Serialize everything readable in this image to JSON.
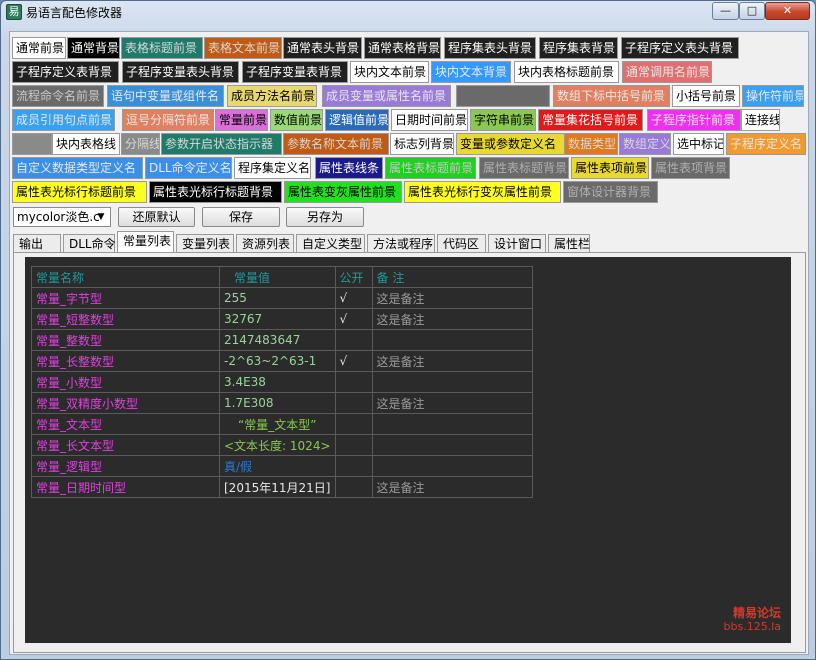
{
  "window": {
    "title": "易语言配色修改器",
    "minimize_glyph": "—",
    "maximize_glyph": "□",
    "close_glyph": "✕"
  },
  "color_buttons": [
    {
      "label": "通常前景",
      "bg": "#ffffff",
      "fg": "#000000"
    },
    {
      "label": "通常背景",
      "bg": "#000000",
      "fg": "#ffffff"
    },
    {
      "label": "表格标题前景",
      "bg": "#1f7a6a",
      "fg": "#d8d8d8"
    },
    {
      "label": "表格文本前景",
      "bg": "#c05a14",
      "fg": "#d8d8d8"
    },
    {
      "label": "通常表头背景",
      "bg": "#202020",
      "fg": "#ffffff"
    },
    {
      "label": "通常表格背景",
      "bg": "#202020",
      "fg": "#ffffff"
    },
    {
      "label": "程序集表头背景",
      "bg": "#202020",
      "fg": "#ffffff"
    },
    {
      "label": "程序集表背景",
      "bg": "#202020",
      "fg": "#ffffff"
    },
    {
      "label": "子程序定义表头背景",
      "bg": "#202020",
      "fg": "#ffffff"
    },
    {
      "label": "子程序定义表背景",
      "bg": "#202020",
      "fg": "#ffffff"
    },
    {
      "label": "子程序变量表头背景",
      "bg": "#202020",
      "fg": "#ffffff"
    },
    {
      "label": "子程序变量表背景",
      "bg": "#202020",
      "fg": "#ffffff"
    },
    {
      "label": "块内文本前景",
      "bg": "#ffffff",
      "fg": "#000000"
    },
    {
      "label": "块内文本背景",
      "bg": "#3399ff",
      "fg": "#e8e8e8"
    },
    {
      "label": "块内表格标题前景",
      "bg": "#ffffff",
      "fg": "#000000"
    },
    {
      "label": "通常调用名前景",
      "bg": "#e07070",
      "fg": "#e8e8e8"
    },
    {
      "label": "流程命令名前景",
      "bg": "#6a6a6a",
      "fg": "#c8c8c8"
    },
    {
      "label": "语句中变量或组件名",
      "bg": "#3a90d8",
      "fg": "#e8e8e8"
    },
    {
      "label": "成员方法名前景",
      "bg": "#e8d870",
      "fg": "#000000"
    },
    {
      "label": "成员变量或属性名前景",
      "bg": "#9a7ad8",
      "fg": "#e8e8e8"
    },
    {
      "label": "",
      "bg": "#6a6a6a",
      "fg": "#ffffff"
    },
    {
      "label": "数组下标中括号前景",
      "bg": "#e08060",
      "fg": "#e8e8e8"
    },
    {
      "label": "小括号前景",
      "bg": "#ffffff",
      "fg": "#000000"
    },
    {
      "label": "操作符前景",
      "bg": "#3aa0f0",
      "fg": "#e8e8e8"
    },
    {
      "label": "成员引用句点前景",
      "bg": "#3aa0f0",
      "fg": "#e8e8e8"
    },
    {
      "label": "逗号分隔符前景",
      "bg": "#e08060",
      "fg": "#e8e8e8"
    },
    {
      "label": "常量前景",
      "bg": "#d870d8",
      "fg": "#000000"
    },
    {
      "label": "数值前景",
      "bg": "#9ad878",
      "fg": "#000000"
    },
    {
      "label": "逻辑值前景",
      "bg": "#2a6ab8",
      "fg": "#ffffff"
    },
    {
      "label": "日期时间前景",
      "bg": "#ffffff",
      "fg": "#000000"
    },
    {
      "label": "字符串前景",
      "bg": "#8ac850",
      "fg": "#000000"
    },
    {
      "label": "常量集花括号前景",
      "bg": "#e01a1a",
      "fg": "#ffffff"
    },
    {
      "label": "子程序指针前景",
      "bg": "#f030f0",
      "fg": "#e8e8e8"
    },
    {
      "label": "连接线",
      "bg": "#ffffff",
      "fg": "#000000"
    },
    {
      "label": "",
      "bg": "#8a8a8a",
      "fg": "#ffffff"
    },
    {
      "label": "块内表格线",
      "bg": "#ffffff",
      "fg": "#000000"
    },
    {
      "label": "分隔线",
      "bg": "#8a8a8a",
      "fg": "#d8d8d8"
    },
    {
      "label": "参数开启状态指示器",
      "bg": "#1f7a6a",
      "fg": "#d8d8d8"
    },
    {
      "label": "参数名称文本前景",
      "bg": "#c05a14",
      "fg": "#d8d8d8"
    },
    {
      "label": "标志列背景",
      "bg": "#ffffff",
      "fg": "#000000"
    },
    {
      "label": "变量或参数定义名",
      "bg": "#e8d830",
      "fg": "#000000"
    },
    {
      "label": "数据类型",
      "bg": "#e07a1a",
      "fg": "#d8d8d8"
    },
    {
      "label": "数组定义",
      "bg": "#9a7ad8",
      "fg": "#d8d8d8"
    },
    {
      "label": "选中标记",
      "bg": "#ffffff",
      "fg": "#000000"
    },
    {
      "label": "子程序定义名",
      "bg": "#f09a30",
      "fg": "#e8e8e8"
    },
    {
      "label": "自定义数据类型定义名",
      "bg": "#3a90e8",
      "fg": "#e8e8e8"
    },
    {
      "label": "DLL命令定义名",
      "bg": "#3a90e8",
      "fg": "#e8e8e8"
    },
    {
      "label": "程序集定义名",
      "bg": "#ffffff",
      "fg": "#000000"
    },
    {
      "label": "属性表线条",
      "bg": "#1a1a8a",
      "fg": "#ffffff"
    },
    {
      "label": "属性表标题前景",
      "bg": "#20d020",
      "fg": "#c8c8c8"
    },
    {
      "label": "属性表标题背景",
      "bg": "#6a6a6a",
      "fg": "#b0b0b0"
    },
    {
      "label": "属性表项前景",
      "bg": "#e8d830",
      "fg": "#000000"
    },
    {
      "label": "属性表项背景",
      "bg": "#6a6a6a",
      "fg": "#b0b0b0"
    },
    {
      "label": "属性表光标行标题前景",
      "bg": "#ffff20",
      "fg": "#000000"
    },
    {
      "label": "属性表光标行标题背景",
      "bg": "#000000",
      "fg": "#ffffff"
    },
    {
      "label": "属性表变灰属性前景",
      "bg": "#20e020",
      "fg": "#000000"
    },
    {
      "label": "属性表光标行变灰属性前景",
      "bg": "#ffff20",
      "fg": "#000000"
    },
    {
      "label": "窗体设计器背景",
      "bg": "#6a6a6a",
      "fg": "#b0b0b0"
    }
  ],
  "toolbar": {
    "combo_value": "mycolor淡色.c",
    "restore_label": "还原默认",
    "save_label": "保存",
    "save_as_label": "另存为"
  },
  "tabs": [
    "输出",
    "DLL命令",
    "常量列表",
    "变量列表",
    "资源列表",
    "自定义类型",
    "方法或程序",
    "代码区",
    "设计窗口",
    "属性栏"
  ],
  "active_tab": "常量列表",
  "const_table": {
    "headers": [
      "常量名称",
      "常量值",
      "公开",
      "备  注"
    ],
    "rows": [
      {
        "name": "常量_字节型",
        "value": "255",
        "public": "√",
        "note": "这是备注",
        "value_color": "#9ad49a"
      },
      {
        "name": "常量_短整数型",
        "value": "32767",
        "public": "√",
        "note": "这是备注",
        "value_color": "#9ad49a"
      },
      {
        "name": "常量_整数型",
        "value": "2147483647",
        "public": "",
        "note": "",
        "value_color": "#9ad49a"
      },
      {
        "name": "常量_长整数型",
        "value": "-2^63~2^63-1",
        "public": "√",
        "note": "这是备注",
        "value_color": "#9ad49a"
      },
      {
        "name": "常量_小数型",
        "value": "3.4E38",
        "public": "",
        "note": "",
        "value_color": "#9ad49a"
      },
      {
        "name": "常量_双精度小数型",
        "value": "1.7E308",
        "public": "",
        "note": "这是备注",
        "value_color": "#9ad49a"
      },
      {
        "name": "常量_文本型",
        "value": "“常量_文本型”",
        "public": "",
        "note": "",
        "value_color": "#8ac850"
      },
      {
        "name": "常量_长文本型",
        "value": "<文本长度: 1024>",
        "public": "",
        "note": "",
        "value_color": "#8ac850"
      },
      {
        "name": "常量_逻辑型",
        "value": "真/假",
        "public": "",
        "note": "",
        "value_color": "#2a7ad8"
      },
      {
        "name": "常量_日期时间型",
        "value": "[2015年11月21日]",
        "public": "",
        "note": "这是备注",
        "value_color": "#e6e6e6"
      }
    ]
  },
  "watermark": {
    "line1": "精易论坛",
    "line2": "bbs.125.la"
  }
}
